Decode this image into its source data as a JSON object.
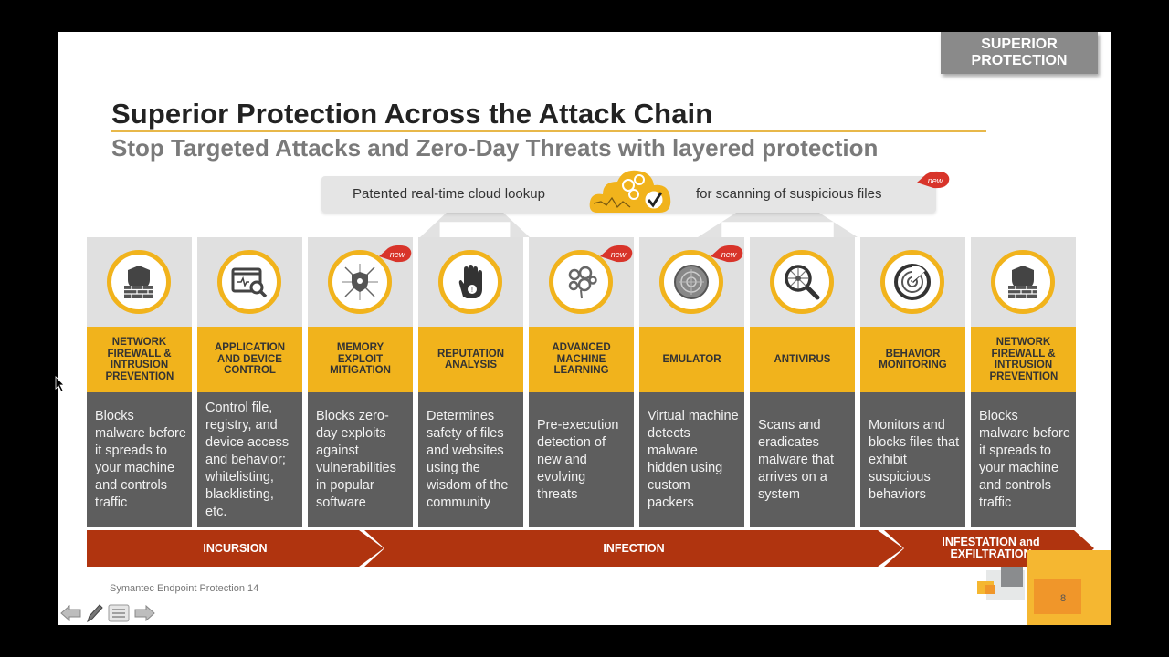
{
  "badge": "SUPERIOR PROTECTION",
  "title": "Superior Protection Across the Attack Chain",
  "subtitle": "Stop Targeted Attacks and Zero-Day Threats with layered protection",
  "cloud": {
    "left_text": "Patented real-time cloud lookup",
    "right_text": "for scanning of suspicious files",
    "icon": "cloud-gears-check-icon",
    "new_tag": "new"
  },
  "colors": {
    "accent_yellow": "#f1b31c",
    "phase_red": "#b0340f",
    "desc_gray": "#5e5e5e",
    "badge_gray": "#8a8a8a"
  },
  "columns": [
    {
      "label": "NETWORK FIREWALL & INTRUSION PREVENTION",
      "icon": "firewall-shield-icon",
      "is_new": false,
      "desc": "Blocks malware before it spreads to your machine and controls traffic"
    },
    {
      "label": "APPLICATION AND DEVICE CONTROL",
      "icon": "app-window-magnifier-icon",
      "is_new": false,
      "desc": "Control file, registry, and device access and behavior; whitelisting, blacklisting, etc."
    },
    {
      "label": "MEMORY EXPLOIT MITIGATION",
      "icon": "shield-arrows-icon",
      "is_new": true,
      "desc": "Blocks zero-day exploits against vulnerabilities in popular software"
    },
    {
      "label": "REPUTATION ANALYSIS",
      "icon": "hand-warning-icon",
      "is_new": false,
      "desc": "Determines safety of files and websites using the wisdom of the community"
    },
    {
      "label": "ADVANCED MACHINE LEARNING",
      "icon": "brain-gears-icon",
      "is_new": true,
      "desc": "Pre-execution detection of new and evolving threats"
    },
    {
      "label": "EMULATOR",
      "icon": "target-disc-icon",
      "is_new": true,
      "desc": "Virtual machine detects malware hidden using custom packers"
    },
    {
      "label": "ANTIVIRUS",
      "icon": "magnifier-virus-icon",
      "is_new": false,
      "desc": "Scans and eradicates malware that arrives on a system"
    },
    {
      "label": "BEHAVIOR MONITORING",
      "icon": "radar-icon",
      "is_new": false,
      "desc": "Monitors and blocks files that exhibit suspicious behaviors"
    },
    {
      "label": "NETWORK FIREWALL & INTRUSION PREVENTION",
      "icon": "firewall-shield-icon",
      "is_new": false,
      "desc": "Blocks malware before it spreads to your machine and controls traffic"
    }
  ],
  "new_tag_label": "new",
  "phases": [
    {
      "label": "INCURSION"
    },
    {
      "label": "INFECTION"
    },
    {
      "label": "INFESTATION and EXFILTRATION"
    }
  ],
  "footer": {
    "product": "Symantec Endpoint Protection 14",
    "page_number": "8"
  },
  "nav": {
    "prev": "previous-slide",
    "pen": "pen-tool",
    "menu": "slide-menu",
    "next": "next-slide"
  }
}
